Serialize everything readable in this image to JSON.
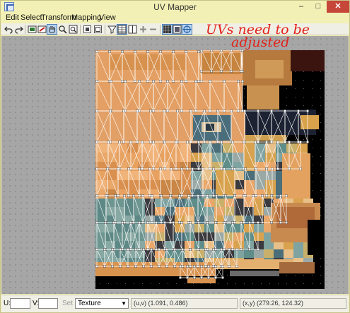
{
  "window": {
    "title": "UV Mapper"
  },
  "titlebar_buttons": {
    "minimize": "–",
    "maximize": "□",
    "close": "✕"
  },
  "menu": {
    "items": [
      "Edit",
      "Select",
      "Transform",
      "Mapping",
      "View"
    ]
  },
  "toolbar": {
    "icons": [
      "undo-icon",
      "redo-icon",
      "select-vertices-icon",
      "select-faces-icon",
      "pan-hand-icon",
      "zoom-icon",
      "zoom-fit-icon",
      "flip-horizontal-icon",
      "flip-vertical-icon",
      "filter-icon",
      "columns-icon",
      "split-icon",
      "add-icon",
      "remove-icon",
      "grid-icon",
      "texture-view-icon",
      "target-icon"
    ],
    "active": "pan-hand-icon"
  },
  "canvas": {
    "annotation_line1": "UVs need to be",
    "annotation_line2": "adjusted",
    "annotation_color": "#e2231a"
  },
  "status": {
    "u_label": "U:",
    "u_value": "",
    "v_label": "V:",
    "v_value": "",
    "set_label": "Set",
    "display_mode": "Texture",
    "uv_readout": "(u,v) (1.091, 0.486)",
    "xy_readout": "(x,y) (279.26, 124.32)"
  }
}
